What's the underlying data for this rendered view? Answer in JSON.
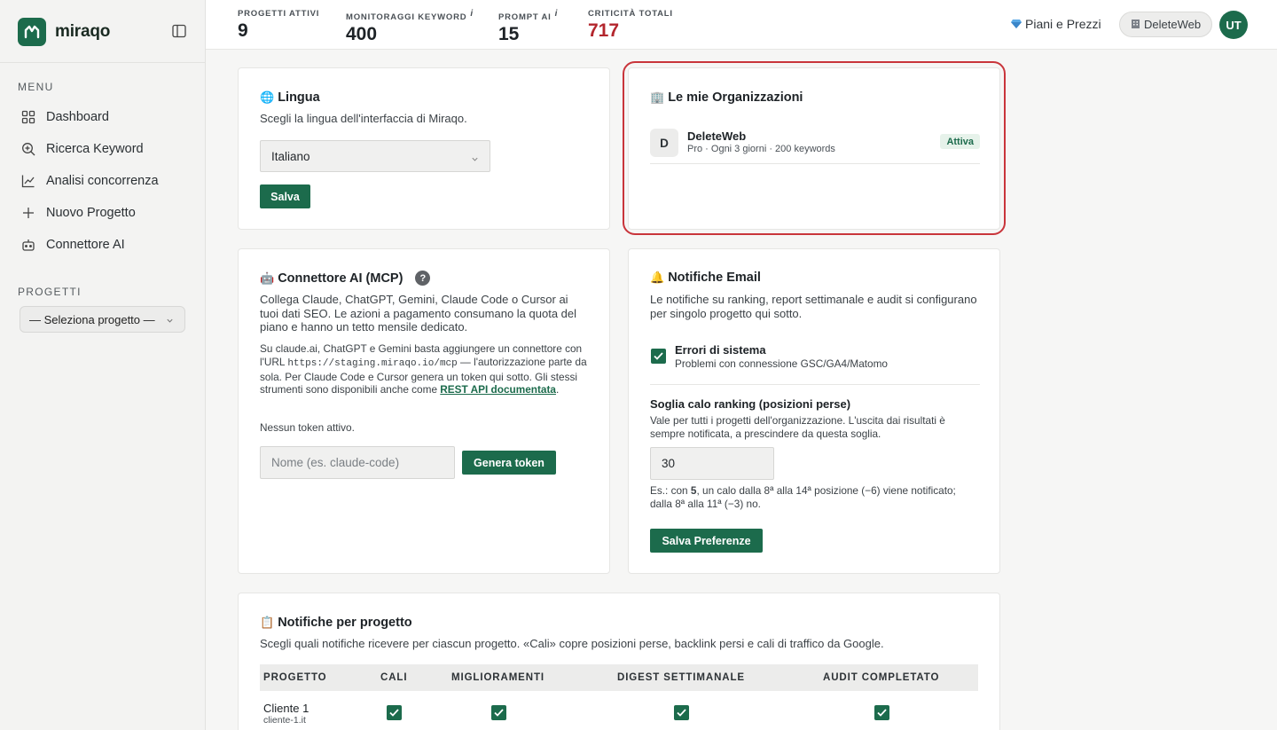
{
  "brand": {
    "name": "miraqo"
  },
  "sidebar": {
    "menu_label": "MENU",
    "items": [
      {
        "label": "Dashboard",
        "icon": "grid-icon"
      },
      {
        "label": "Ricerca Keyword",
        "icon": "search-plus-icon"
      },
      {
        "label": "Analisi concorrenza",
        "icon": "line-chart-icon"
      },
      {
        "label": "Nuovo Progetto",
        "icon": "plus-icon"
      },
      {
        "label": "Connettore AI",
        "icon": "robot-icon"
      }
    ],
    "projects_label": "PROGETTI",
    "project_select": "— Seleziona progetto —"
  },
  "topbar": {
    "stats": [
      {
        "label": "PROGETTI ATTIVI",
        "value": "9",
        "info": ""
      },
      {
        "label": "MONITORAGGI KEYWORD",
        "value": "400",
        "info": "i"
      },
      {
        "label": "PROMPT AI",
        "value": "15",
        "info": "i"
      },
      {
        "label": "CRITICITÀ TOTALI",
        "value": "717",
        "info": ""
      }
    ],
    "plans_link": "Piani e Prezzi",
    "org_pill": "DeleteWeb",
    "avatar_initials": "UT"
  },
  "language_card": {
    "title": "Lingua",
    "desc": "Scegli la lingua dell'interfaccia di Miraqo.",
    "selected": "Italiano",
    "save_label": "Salva"
  },
  "orgs_card": {
    "title": "Le mie Organizzazioni",
    "org": {
      "initial": "D",
      "name": "DeleteWeb",
      "meta": "Pro · Ogni 3 giorni · 200 keywords",
      "badge": "Attiva"
    }
  },
  "mcp_card": {
    "title": "Connettore AI (MCP)",
    "help": "?",
    "desc": "Collega Claude, ChatGPT, Gemini, Claude Code o Cursor ai tuoi dati SEO. Le azioni a pagamento consumano la quota del piano e hanno un tetto mensile dedicato.",
    "note_part1": "Su claude.ai, ChatGPT e Gemini basta aggiungere un connettore con l'URL",
    "note_url": "https://staging.miraqo.io/mcp",
    "note_part2": "— l'autorizzazione parte da sola. Per Claude Code e Cursor genera un token qui sotto. Gli stessi strumenti sono disponibili anche come",
    "note_link": "REST API documentata",
    "note_end": ".",
    "no_token": "Nessun token attivo.",
    "token_placeholder": "Nome (es. claude-code)",
    "generate_label": "Genera token"
  },
  "email_card": {
    "title": "Notifiche Email",
    "desc": "Le notifiche su ranking, report settimanale e audit si configurano per singolo progetto qui sotto.",
    "errors_title": "Errori di sistema",
    "errors_desc": "Problemi con connessione GSC/GA4/Matomo",
    "threshold_title": "Soglia calo ranking (posizioni perse)",
    "threshold_desc": "Vale per tutti i progetti dell'organizzazione. L'uscita dai risultati è sempre notificata, a prescindere da questa soglia.",
    "threshold_value": "30",
    "example_prefix": "Es.: con",
    "example_number": "5",
    "example_rest": ", un calo dalla 8ª alla 14ª posizione (−6) viene notificato; dalla 8ª alla 11ª (−3) no.",
    "save_label": "Salva Preferenze"
  },
  "project_notifications": {
    "title": "Notifiche per progetto",
    "desc": "Scegli quali notifiche ricevere per ciascun progetto. «Cali» copre posizioni perse, backlink persi e cali di traffico da Google.",
    "columns": [
      "PROGETTO",
      "CALI",
      "MIGLIORAMENTI",
      "DIGEST SETTIMANALE",
      "AUDIT COMPLETATO"
    ],
    "rows": [
      {
        "name": "Cliente 1",
        "domain": "cliente-1.it",
        "cali": true,
        "miglioramenti": true,
        "digest": true,
        "audit": true
      }
    ]
  },
  "colors": {
    "brand": "#1c6b4c",
    "danger": "#b3262d",
    "highlight": "#c9353b"
  }
}
